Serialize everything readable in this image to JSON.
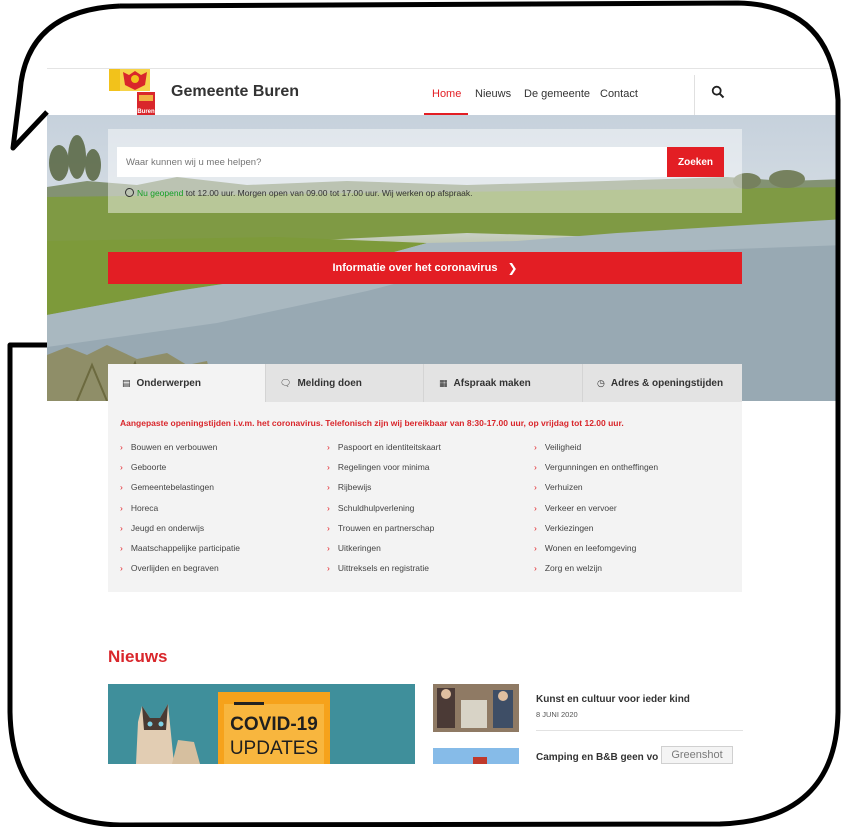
{
  "header": {
    "site_title": "Gemeente Buren",
    "logo_name": "Buren",
    "nav": [
      {
        "label": "Home",
        "active": true
      },
      {
        "label": "Nieuws",
        "active": false
      },
      {
        "label": "De gemeente",
        "active": false
      },
      {
        "label": "Contact",
        "active": false
      }
    ]
  },
  "search": {
    "placeholder": "Waar kunnen wij u mee helpen?",
    "button_label": "Zoeken"
  },
  "opening": {
    "status": "Nu geopend",
    "text": "tot 12.00 uur. Morgen open van 09.00 tot 17.00 uur. Wij werken op afspraak."
  },
  "corona_banner": {
    "label": "Informatie over het coronavirus"
  },
  "tabs": [
    {
      "label": "Onderwerpen",
      "icon": "list-icon",
      "active": true
    },
    {
      "label": "Melding doen",
      "icon": "chat-icon",
      "active": false
    },
    {
      "label": "Afspraak maken",
      "icon": "calendar-icon",
      "active": false
    },
    {
      "label": "Adres & openingstijden",
      "icon": "clock-icon",
      "active": false
    }
  ],
  "notice": "Aangepaste openingstijden i.v.m. het coronavirus. Telefonisch zijn wij bereikbaar van 8:30-17.00 uur, op vrijdag tot 12.00 uur.",
  "topics": [
    [
      "Bouwen en verbouwen",
      "Geboorte",
      "Gemeentebelastingen",
      "Horeca",
      "Jeugd en onderwijs",
      "Maatschappelijke participatie",
      "Overlijden en begraven"
    ],
    [
      "Paspoort en identiteitskaart",
      "Regelingen voor minima",
      "Rijbewijs",
      "Schuldhulpverlening",
      "Trouwen en partnerschap",
      "Uitkeringen",
      "Uittreksels en registratie"
    ],
    [
      "Veiligheid",
      "Vergunningen en ontheffingen",
      "Verhuizen",
      "Verkeer en vervoer",
      "Verkiezingen",
      "Wonen en leefomgeving",
      "Zorg en welzijn"
    ]
  ],
  "news": {
    "heading": "Nieuws",
    "featured_image_text": [
      "COVID-19",
      "UPDATES"
    ],
    "items": [
      {
        "title": "Kunst en cultuur voor ieder kind",
        "date": "8 JUNI 2020"
      },
      {
        "title": "Camping en B&B geen vo",
        "date": ""
      }
    ]
  },
  "overlay_label": "Greenshot",
  "colors": {
    "accent": "#e31e24",
    "open_green": "#14a01e",
    "panel": "#f3f3f3"
  }
}
